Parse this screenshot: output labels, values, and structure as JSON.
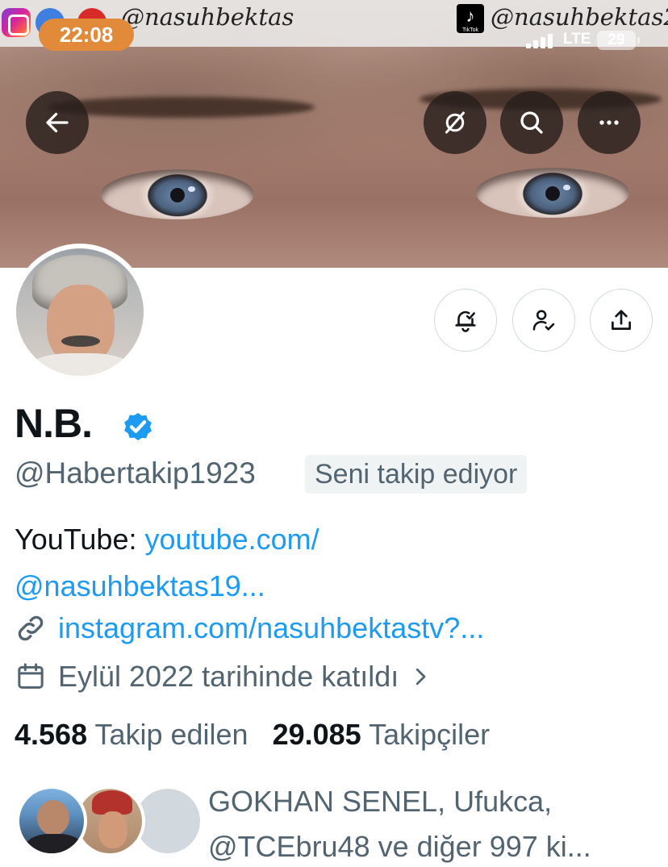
{
  "status_bar": {
    "overlay_left_handle": "@nasuhbektas",
    "overlay_right_handle": "@nasuhbektas2",
    "tiktok_label": "TikTok",
    "time": "22:08",
    "network": "LTE",
    "battery": "29"
  },
  "banner_actions": {
    "back": "back-arrow",
    "hide": "eye-slash",
    "search": "search",
    "more": "more-dots"
  },
  "profile_actions": [
    "notifications-bell",
    "following-person-check",
    "share"
  ],
  "profile": {
    "name": "N.B.",
    "verified": true,
    "handle": "@Habertakip1923",
    "follows_you": "Seni takip ediyor",
    "bio_prefix": "YouTube: ",
    "bio_link_line1": "youtube.com/",
    "bio_link_line2": "@nasuhbektas19...",
    "website": "instagram.com/nasuhbektastv?...",
    "joined": "Eylül 2022 tarihinde katıldı",
    "following_count": "4.568",
    "following_label": "Takip edilen",
    "followers_count": "29.085",
    "followers_label": "Takipçiler",
    "mutuals_line1": "GOKHAN SENEL, Ufukca,",
    "mutuals_line2": "@TCEbru48 ve diğer 997 ki..."
  },
  "colors": {
    "accent": "#1d9bf0",
    "secondary_text": "#536471",
    "verified": "#1d9bf0"
  }
}
